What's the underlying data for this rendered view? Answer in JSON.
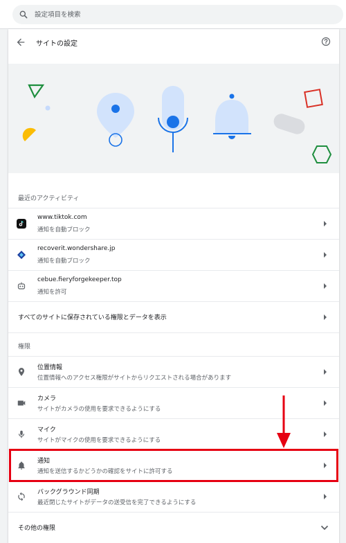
{
  "search": {
    "placeholder": "設定項目を検索",
    "icon": "search-icon"
  },
  "header": {
    "title": "サイトの設定",
    "back_icon": "arrow-back-icon",
    "help_icon": "help-icon"
  },
  "recent": {
    "label": "最近のアクティビティ",
    "items": [
      {
        "site": "www.tiktok.com",
        "status": "通知を自動ブロック",
        "icon": "tiktok-favicon"
      },
      {
        "site": "recoverit.wondershare.jp",
        "status": "通知を自動ブロック",
        "icon": "wondershare-favicon"
      },
      {
        "site": "cebue.fieryforgekeeper.top",
        "status": "通知を許可",
        "icon": "robot-favicon"
      }
    ],
    "view_all": "すべてのサイトに保存されている権限とデータを表示"
  },
  "permissions": {
    "label": "権限",
    "items": [
      {
        "title": "位置情報",
        "desc": "位置情報へのアクセス権限がサイトからリクエストされる場合があります",
        "icon": "location-icon"
      },
      {
        "title": "カメラ",
        "desc": "サイトがカメラの使用を要求できるようにする",
        "icon": "camera-icon"
      },
      {
        "title": "マイク",
        "desc": "サイトがマイクの使用を要求できるようにする",
        "icon": "mic-icon"
      },
      {
        "title": "通知",
        "desc": "通知を送信するかどうかの確認をサイトに許可する",
        "icon": "bell-icon"
      },
      {
        "title": "バックグラウンド同期",
        "desc": "最近閉じたサイトがデータの送受信を完了できるようにする",
        "icon": "sync-icon"
      }
    ],
    "more": "その他の権限"
  },
  "colors": {
    "highlight": "#e60012",
    "accent": "#1a73e8",
    "banner_bg": "#f1f3f4"
  }
}
